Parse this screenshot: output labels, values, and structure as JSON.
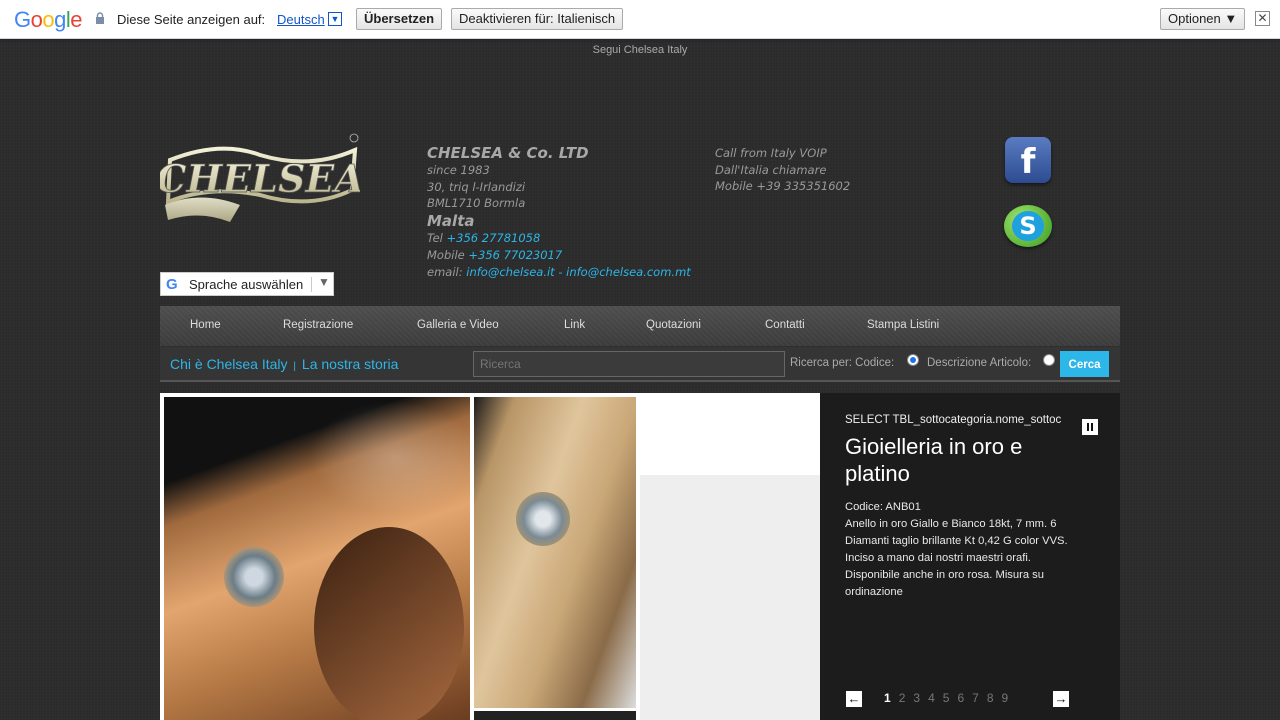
{
  "translate_bar": {
    "logo": "Google",
    "prompt": "Diese Seite anzeigen auf:",
    "language": "Deutsch",
    "translate_label": "Übersetzen",
    "deactivate_label": "Deaktivieren für: Italienisch",
    "options_label": "Optionen ▼",
    "close_label": "✕"
  },
  "follow_text": "Segui Chelsea Italy",
  "logo_text": "CHELSEA",
  "lang_select": {
    "label": "Sprache auswählen"
  },
  "address": {
    "company": "CHELSEA & Co. LTD",
    "since": "since 1983",
    "street": "30, triq l-Irlandizi",
    "city": "BML1710 Bormla",
    "country": "Malta",
    "tel_label": "Tel ",
    "tel": "+356 27781058",
    "mobile_label": "Mobile ",
    "mobile": "+356 77023017",
    "email_label": "email: ",
    "email": "info@chelsea.it - info@chelsea.com.mt"
  },
  "call": {
    "line1": "Call from Italy VOIP",
    "line2": "Dall'Italia chiamare",
    "line3": "Mobile +39 335351602"
  },
  "nav": [
    "Home",
    "Registrazione",
    "Galleria e Video",
    "Link",
    "Quotazioni",
    "Contatti",
    "Stampa Listini"
  ],
  "subbar": {
    "story1": "Chi è Chelsea Italy",
    "pipe": "|",
    "story2": "La nostra storia",
    "search_placeholder": "Ricerca",
    "search_by": "Ricerca per: Codice:",
    "desc_label": "Descrizione Articolo:",
    "search_button": "Cerca"
  },
  "panel": {
    "sql": "SELECT TBL_sottocategoria.nome_sottoc",
    "title": "Gioielleria in oro e platino",
    "code": "Codice: ANB01",
    "description": "Anello in oro Giallo e Bianco 18kt, 7 mm. 6 Diamanti taglio brillante Kt 0,42 G color VVS. Inciso a mano dai nostri maestri orafi. Disponibile anche in oro rosa. Misura su ordinazione",
    "pages": [
      "1",
      "2",
      "3",
      "4",
      "5",
      "6",
      "7",
      "8",
      "9"
    ],
    "current_page": "1"
  }
}
